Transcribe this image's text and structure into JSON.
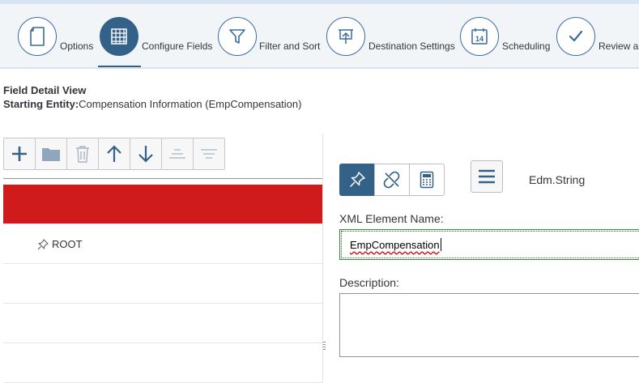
{
  "wizard": {
    "steps": [
      {
        "label": "Options",
        "icon": "document-icon",
        "active": false
      },
      {
        "label": "Configure Fields",
        "icon": "grid-icon",
        "active": true
      },
      {
        "label": "Filter and Sort",
        "icon": "filter-icon",
        "active": false
      },
      {
        "label": "Destination Settings",
        "icon": "upload-screen-icon",
        "active": false
      },
      {
        "label": "Scheduling",
        "icon": "calendar-icon",
        "active": false,
        "badge": "14"
      },
      {
        "label": "Review ar",
        "icon": "checkmark-icon",
        "active": false
      }
    ]
  },
  "detail": {
    "title": "Field Detail View",
    "entity_label": "Starting Entity:",
    "entity_value": "Compensation Information (EmpCompensation)"
  },
  "toolbar": {
    "buttons": [
      "add-icon",
      "folder-icon",
      "trash-icon",
      "arrow-up-icon",
      "arrow-down-icon",
      "align-top-icon",
      "align-center-icon"
    ]
  },
  "tree": {
    "rows": [
      {
        "label": "",
        "selected": true
      },
      {
        "label": "ROOT",
        "icon": "pin-icon"
      },
      {
        "label": ""
      },
      {
        "label": ""
      },
      {
        "label": ""
      }
    ]
  },
  "fieldtype": {
    "buttons": [
      "pin-icon",
      "unlink-icon",
      "calculator-icon"
    ],
    "active": 0
  },
  "datatype": "Edm.String",
  "xml_element": {
    "label": "XML Element Name:",
    "value": "EmpCompensation"
  },
  "description": {
    "label": "Description:",
    "value": ""
  },
  "colors": {
    "accent": "#346187",
    "selected_row": "#cf1b1b",
    "input_border_valid": "#3b8a3b"
  }
}
